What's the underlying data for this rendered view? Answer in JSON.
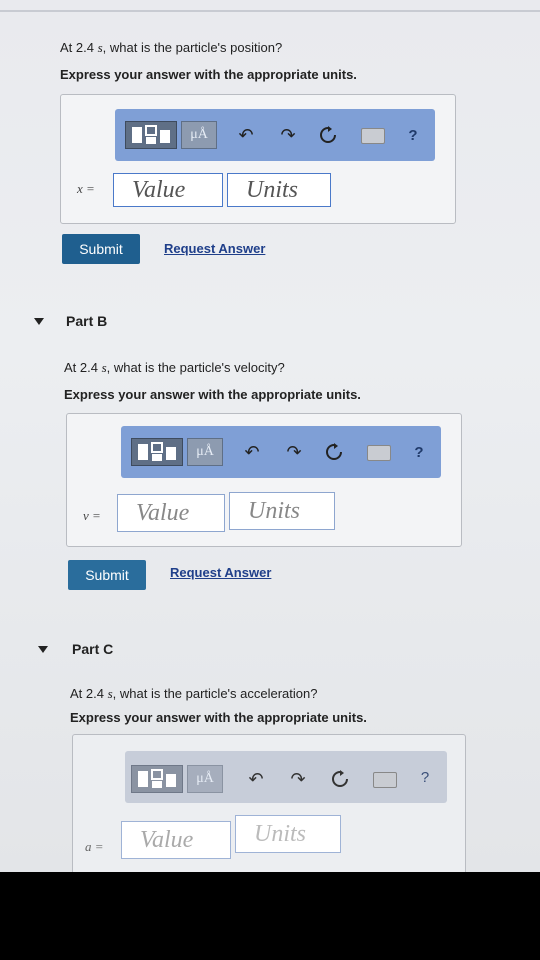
{
  "partA": {
    "question_prefix": "At 2.4",
    "question_unit": "s",
    "question_suffix": ", what is the particle's position?",
    "instruction": "Express your answer with the appropriate units.",
    "variable": "x =",
    "value_placeholder": "Value",
    "units_placeholder": "Units",
    "submit_label": "Submit",
    "request_label": "Request Answer"
  },
  "partB": {
    "title": "Part B",
    "question_prefix": "At 2.4",
    "question_unit": "s",
    "question_suffix": ", what is the particle's velocity?",
    "instruction": "Express your answer with the appropriate units.",
    "variable": "v =",
    "value_placeholder": "Value",
    "units_placeholder": "Units",
    "submit_label": "Submit",
    "request_label": "Request Answer"
  },
  "partC": {
    "title": "Part C",
    "question_prefix": "At 2.4",
    "question_unit": "s",
    "question_suffix": ", what is the particle's acceleration?",
    "instruction": "Express your answer with the appropriate units.",
    "variable": "a =",
    "value_placeholder": "Value",
    "units_placeholder": "Units"
  },
  "toolbar": {
    "units_symbol": "μÅ",
    "help_symbol": "?",
    "icons": [
      "templates-icon",
      "units-icon",
      "undo-icon",
      "redo-icon",
      "reset-icon",
      "keyboard-icon",
      "help-icon"
    ]
  },
  "colors": {
    "toolbar": "#7f9fd6",
    "submit": "#1f5f8f",
    "link": "#1f3f8a",
    "field_border": "#4a79c9"
  }
}
